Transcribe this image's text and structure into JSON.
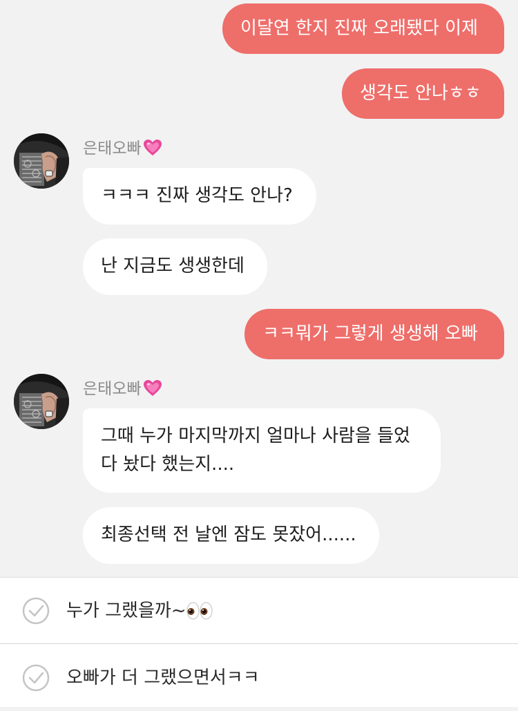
{
  "messages": [
    {
      "from": "me",
      "text": "이달연 한지 진짜 오래됐다 이제"
    },
    {
      "from": "me",
      "text": "생각도 안나ㅎㅎ"
    },
    {
      "from": "them",
      "sender": "은태오빠",
      "text": "ㅋㅋㅋ 진짜 생각도 안나?"
    },
    {
      "from": "them",
      "text": "난 지금도 생생한데"
    },
    {
      "from": "me",
      "text": "ㅋㅋ뭐가 그렇게 생생해 오빠"
    },
    {
      "from": "them",
      "sender": "은태오빠",
      "text": "그때 누가 마지막까지 얼마나 사람을 들었다 놨다 했는지...."
    },
    {
      "from": "them",
      "text": "최종선택 전 날엔 잠도 못잤어......"
    }
  ],
  "choices": [
    {
      "text": "누가 그랬을까~",
      "emoji": "eyes-emoji"
    },
    {
      "text": "오빠가 더 그랬으면서ㅋㅋ"
    }
  ],
  "colors": {
    "my_bubble": "#ee6e6a",
    "their_bubble": "#ffffff",
    "background": "#f2f2f2",
    "heart": "#e9479a"
  }
}
